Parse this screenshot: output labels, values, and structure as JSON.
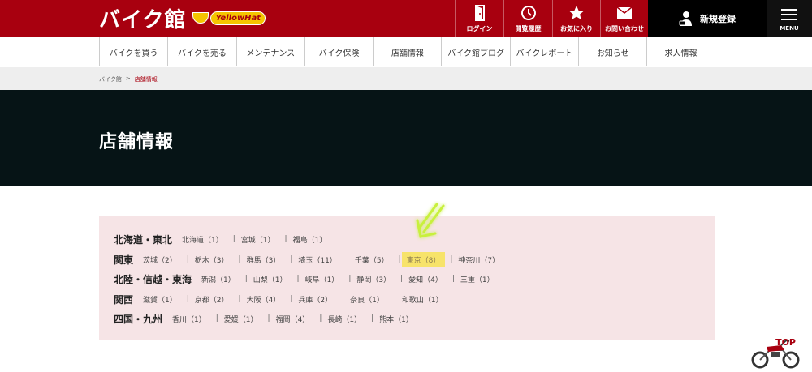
{
  "brand": {
    "logo": "バイク館",
    "partner": "YellowHat"
  },
  "header_nav": [
    {
      "label": "ログイン",
      "icon": "login-door-icon"
    },
    {
      "label": "閲覧履歴",
      "icon": "history-clock-icon"
    },
    {
      "label": "お気に入り",
      "icon": "star-icon"
    },
    {
      "label": "お問い合わせ",
      "icon": "mail-icon"
    }
  ],
  "signup": {
    "label": "新規登録",
    "icon": "user-add-icon"
  },
  "menu": {
    "label": "MENU"
  },
  "global_nav": [
    "バイクを買う",
    "バイクを売る",
    "メンテナンス",
    "バイク保険",
    "店舗情報",
    "バイク館ブログ",
    "バイクレポート",
    "お知らせ",
    "求人情報"
  ],
  "breadcrumb": {
    "home": "バイク館",
    "separator": ">",
    "current": "店舗情報"
  },
  "hero": {
    "title": "店舗情報"
  },
  "regions": [
    {
      "name": "北海道・東北",
      "prefs": [
        "北海道（1）",
        "宮城（1）",
        "福島（1）"
      ]
    },
    {
      "name": "関東",
      "prefs": [
        "茨城（2）",
        "栃木（3）",
        "群馬（3）",
        "埼玉（11）",
        "千葉（5）",
        "東京（8）",
        "神奈川（7）"
      ]
    },
    {
      "name": "北陸・信越・東海",
      "prefs": [
        "新潟（1）",
        "山梨（1）",
        "岐阜（1）",
        "静岡（3）",
        "愛知（4）",
        "三重（1）"
      ]
    },
    {
      "name": "関西",
      "prefs": [
        "滋賀（1）",
        "京都（2）",
        "大阪（4）",
        "兵庫（2）",
        "奈良（1）",
        "和歌山（1）"
      ]
    },
    {
      "name": "四国・九州",
      "prefs": [
        "香川（1）",
        "愛媛（1）",
        "福岡（4）",
        "長崎（1）",
        "熊本（1）"
      ]
    }
  ],
  "highlight": {
    "region": 1,
    "pref": 5,
    "color": "#f7e36a"
  },
  "top_button": {
    "label": "TOP"
  },
  "colors": {
    "brand_red": "#a8000f",
    "hero_bg": "#061416",
    "region_bg": "#f6e4e6",
    "arrow": "#c8f03c"
  }
}
